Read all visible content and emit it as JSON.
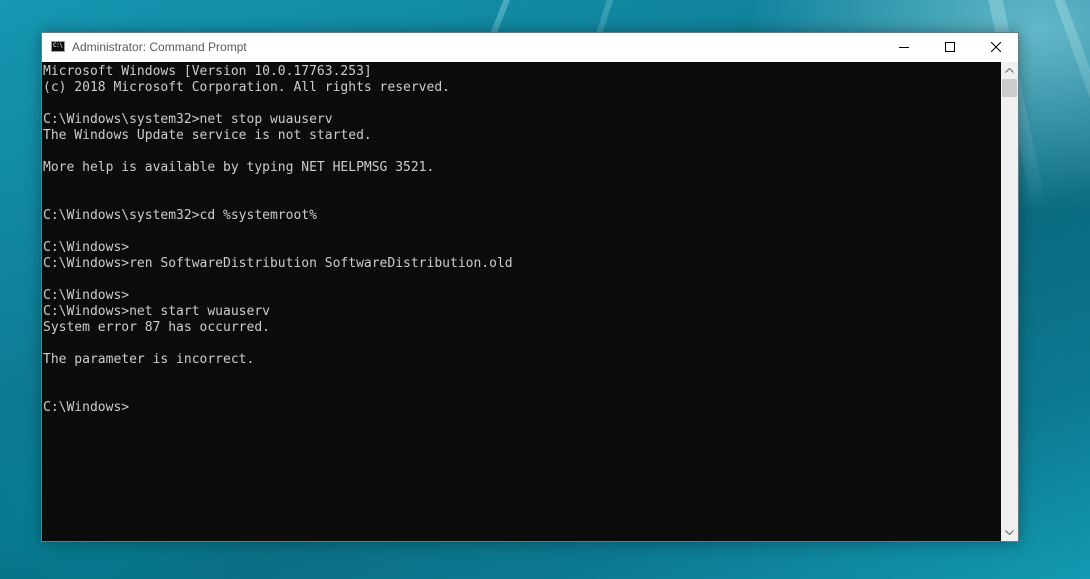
{
  "window": {
    "title": "Administrator: Command Prompt",
    "icon": "cmd-icon",
    "icon_text": "C:\\"
  },
  "controls": {
    "minimize": "minimize-icon",
    "maximize": "maximize-icon",
    "close": "close-icon"
  },
  "console": {
    "background": "#0c0c0c",
    "foreground": "#cccccc",
    "lines": [
      "Microsoft Windows [Version 10.0.17763.253]",
      "(c) 2018 Microsoft Corporation. All rights reserved.",
      "",
      "C:\\Windows\\system32>net stop wuauserv",
      "The Windows Update service is not started.",
      "",
      "More help is available by typing NET HELPMSG 3521.",
      "",
      "",
      "C:\\Windows\\system32>cd %systemroot%",
      "",
      "C:\\Windows>",
      "C:\\Windows>ren SoftwareDistribution SoftwareDistribution.old",
      "",
      "C:\\Windows>",
      "C:\\Windows>net start wuauserv",
      "System error 87 has occurred.",
      "",
      "The parameter is incorrect.",
      "",
      "",
      "C:\\Windows>"
    ]
  },
  "scrollbar": {
    "up": "scroll-up-arrow-icon",
    "down": "scroll-down-arrow-icon"
  }
}
